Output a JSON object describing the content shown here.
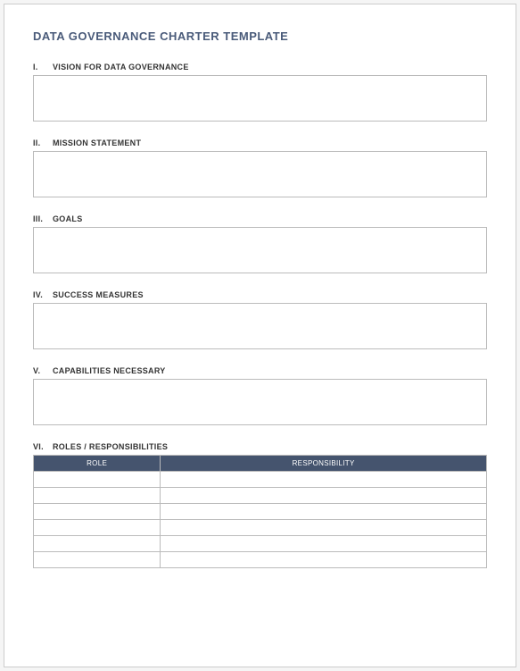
{
  "title": "DATA GOVERNANCE CHARTER TEMPLATE",
  "sections": [
    {
      "numeral": "I.",
      "label": "VISION FOR DATA GOVERNANCE",
      "value": ""
    },
    {
      "numeral": "II.",
      "label": "MISSION STATEMENT",
      "value": ""
    },
    {
      "numeral": "III.",
      "label": "GOALS",
      "value": ""
    },
    {
      "numeral": "IV.",
      "label": "SUCCESS MEASURES",
      "value": ""
    },
    {
      "numeral": "V.",
      "label": "CAPABILITIES NECESSARY",
      "value": ""
    }
  ],
  "rolesSection": {
    "numeral": "VI.",
    "label": "ROLES / RESPONSIBILITIES",
    "columns": [
      "ROLE",
      "RESPONSIBILITY"
    ],
    "rows": [
      {
        "role": "",
        "responsibility": ""
      },
      {
        "role": "",
        "responsibility": ""
      },
      {
        "role": "",
        "responsibility": ""
      },
      {
        "role": "",
        "responsibility": ""
      },
      {
        "role": "",
        "responsibility": ""
      },
      {
        "role": "",
        "responsibility": ""
      }
    ]
  }
}
